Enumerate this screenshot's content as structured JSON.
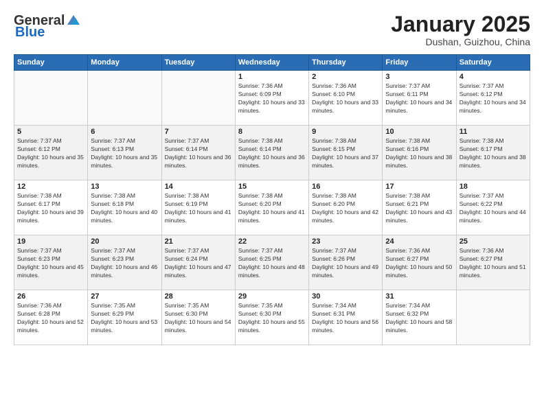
{
  "header": {
    "logo_general": "General",
    "logo_blue": "Blue",
    "month": "January 2025",
    "location": "Dushan, Guizhou, China"
  },
  "days_of_week": [
    "Sunday",
    "Monday",
    "Tuesday",
    "Wednesday",
    "Thursday",
    "Friday",
    "Saturday"
  ],
  "weeks": [
    [
      {
        "day": "",
        "info": ""
      },
      {
        "day": "",
        "info": ""
      },
      {
        "day": "",
        "info": ""
      },
      {
        "day": "1",
        "info": "Sunrise: 7:36 AM\nSunset: 6:09 PM\nDaylight: 10 hours and 33 minutes."
      },
      {
        "day": "2",
        "info": "Sunrise: 7:36 AM\nSunset: 6:10 PM\nDaylight: 10 hours and 33 minutes."
      },
      {
        "day": "3",
        "info": "Sunrise: 7:37 AM\nSunset: 6:11 PM\nDaylight: 10 hours and 34 minutes."
      },
      {
        "day": "4",
        "info": "Sunrise: 7:37 AM\nSunset: 6:12 PM\nDaylight: 10 hours and 34 minutes."
      }
    ],
    [
      {
        "day": "5",
        "info": "Sunrise: 7:37 AM\nSunset: 6:12 PM\nDaylight: 10 hours and 35 minutes."
      },
      {
        "day": "6",
        "info": "Sunrise: 7:37 AM\nSunset: 6:13 PM\nDaylight: 10 hours and 35 minutes."
      },
      {
        "day": "7",
        "info": "Sunrise: 7:37 AM\nSunset: 6:14 PM\nDaylight: 10 hours and 36 minutes."
      },
      {
        "day": "8",
        "info": "Sunrise: 7:38 AM\nSunset: 6:14 PM\nDaylight: 10 hours and 36 minutes."
      },
      {
        "day": "9",
        "info": "Sunrise: 7:38 AM\nSunset: 6:15 PM\nDaylight: 10 hours and 37 minutes."
      },
      {
        "day": "10",
        "info": "Sunrise: 7:38 AM\nSunset: 6:16 PM\nDaylight: 10 hours and 38 minutes."
      },
      {
        "day": "11",
        "info": "Sunrise: 7:38 AM\nSunset: 6:17 PM\nDaylight: 10 hours and 38 minutes."
      }
    ],
    [
      {
        "day": "12",
        "info": "Sunrise: 7:38 AM\nSunset: 6:17 PM\nDaylight: 10 hours and 39 minutes."
      },
      {
        "day": "13",
        "info": "Sunrise: 7:38 AM\nSunset: 6:18 PM\nDaylight: 10 hours and 40 minutes."
      },
      {
        "day": "14",
        "info": "Sunrise: 7:38 AM\nSunset: 6:19 PM\nDaylight: 10 hours and 41 minutes."
      },
      {
        "day": "15",
        "info": "Sunrise: 7:38 AM\nSunset: 6:20 PM\nDaylight: 10 hours and 41 minutes."
      },
      {
        "day": "16",
        "info": "Sunrise: 7:38 AM\nSunset: 6:20 PM\nDaylight: 10 hours and 42 minutes."
      },
      {
        "day": "17",
        "info": "Sunrise: 7:38 AM\nSunset: 6:21 PM\nDaylight: 10 hours and 43 minutes."
      },
      {
        "day": "18",
        "info": "Sunrise: 7:37 AM\nSunset: 6:22 PM\nDaylight: 10 hours and 44 minutes."
      }
    ],
    [
      {
        "day": "19",
        "info": "Sunrise: 7:37 AM\nSunset: 6:23 PM\nDaylight: 10 hours and 45 minutes."
      },
      {
        "day": "20",
        "info": "Sunrise: 7:37 AM\nSunset: 6:23 PM\nDaylight: 10 hours and 46 minutes."
      },
      {
        "day": "21",
        "info": "Sunrise: 7:37 AM\nSunset: 6:24 PM\nDaylight: 10 hours and 47 minutes."
      },
      {
        "day": "22",
        "info": "Sunrise: 7:37 AM\nSunset: 6:25 PM\nDaylight: 10 hours and 48 minutes."
      },
      {
        "day": "23",
        "info": "Sunrise: 7:37 AM\nSunset: 6:26 PM\nDaylight: 10 hours and 49 minutes."
      },
      {
        "day": "24",
        "info": "Sunrise: 7:36 AM\nSunset: 6:27 PM\nDaylight: 10 hours and 50 minutes."
      },
      {
        "day": "25",
        "info": "Sunrise: 7:36 AM\nSunset: 6:27 PM\nDaylight: 10 hours and 51 minutes."
      }
    ],
    [
      {
        "day": "26",
        "info": "Sunrise: 7:36 AM\nSunset: 6:28 PM\nDaylight: 10 hours and 52 minutes."
      },
      {
        "day": "27",
        "info": "Sunrise: 7:35 AM\nSunset: 6:29 PM\nDaylight: 10 hours and 53 minutes."
      },
      {
        "day": "28",
        "info": "Sunrise: 7:35 AM\nSunset: 6:30 PM\nDaylight: 10 hours and 54 minutes."
      },
      {
        "day": "29",
        "info": "Sunrise: 7:35 AM\nSunset: 6:30 PM\nDaylight: 10 hours and 55 minutes."
      },
      {
        "day": "30",
        "info": "Sunrise: 7:34 AM\nSunset: 6:31 PM\nDaylight: 10 hours and 56 minutes."
      },
      {
        "day": "31",
        "info": "Sunrise: 7:34 AM\nSunset: 6:32 PM\nDaylight: 10 hours and 58 minutes."
      },
      {
        "day": "",
        "info": ""
      }
    ]
  ]
}
